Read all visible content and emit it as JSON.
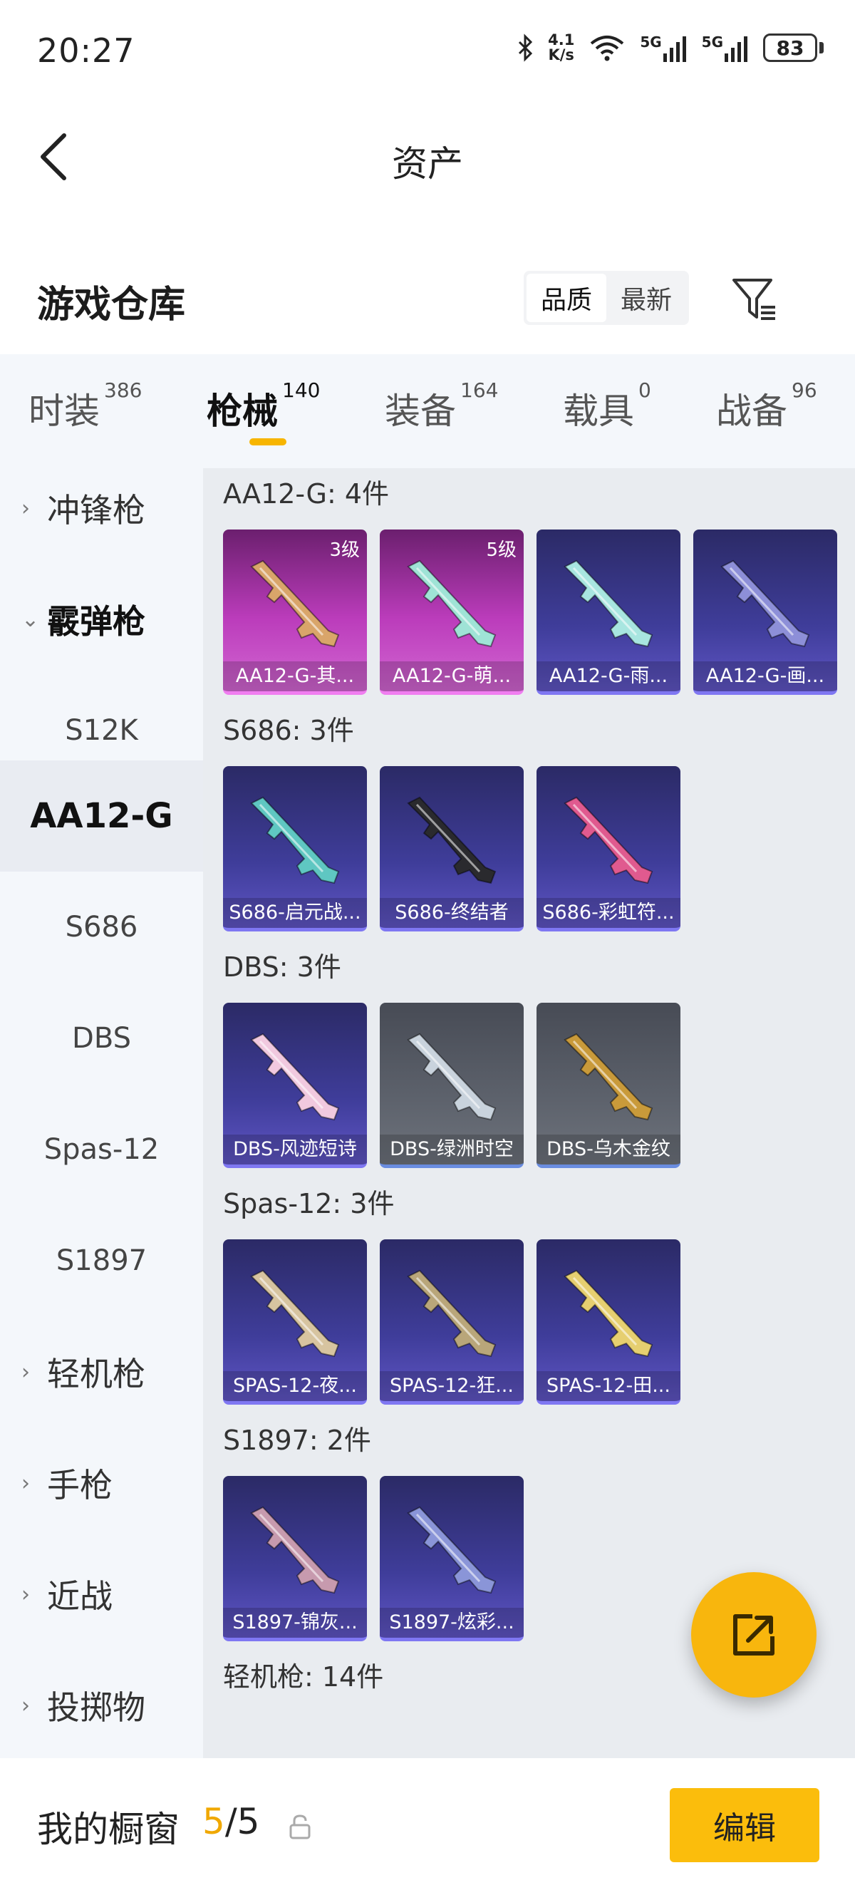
{
  "status": {
    "time": "20:27",
    "net_speed_top": "4.1",
    "net_speed_unit": "K/s",
    "sig1": "5G",
    "sig2": "5G",
    "battery": "83"
  },
  "header": {
    "title": "资产"
  },
  "warehouse": {
    "title": "游戏仓库",
    "sort_options": [
      "品质",
      "最新"
    ],
    "active_sort": "品质"
  },
  "tabs": [
    {
      "label": "时装",
      "count": "386"
    },
    {
      "label": "枪械",
      "count": "140",
      "active": true
    },
    {
      "label": "装备",
      "count": "164"
    },
    {
      "label": "载具",
      "count": "0"
    },
    {
      "label": "战备",
      "count": "96"
    }
  ],
  "sidebar": {
    "items": [
      {
        "label": "冲锋枪",
        "kind": "group"
      },
      {
        "label": "霰弹枪",
        "kind": "group",
        "expanded": true
      },
      {
        "label": "S12K",
        "kind": "sub"
      },
      {
        "label": "AA12-G",
        "kind": "sub",
        "selected": true
      },
      {
        "label": "S686",
        "kind": "sub"
      },
      {
        "label": "DBS",
        "kind": "sub"
      },
      {
        "label": "Spas-12",
        "kind": "sub"
      },
      {
        "label": "S1897",
        "kind": "sub"
      },
      {
        "label": "轻机枪",
        "kind": "group"
      },
      {
        "label": "手枪",
        "kind": "group"
      },
      {
        "label": "近战",
        "kind": "group"
      },
      {
        "label": "投掷物",
        "kind": "group"
      }
    ]
  },
  "sections": [
    {
      "title": "AA12-G: 4件",
      "items": [
        {
          "name": "AA12-G-其...",
          "level": "3级",
          "rarity": "pink",
          "color": "#d9a56a"
        },
        {
          "name": "AA12-G-萌...",
          "level": "5级",
          "rarity": "pink",
          "color": "#9fe3d6"
        },
        {
          "name": "AA12-G-雨...",
          "rarity": "purple",
          "color": "#a8e6e0"
        },
        {
          "name": "AA12-G-画...",
          "rarity": "purple",
          "color": "#8d8fd8"
        }
      ]
    },
    {
      "title": "S686: 3件",
      "items": [
        {
          "name": "S686-启元战...",
          "rarity": "purple",
          "color": "#5fc7c2"
        },
        {
          "name": "S686-终结者",
          "rarity": "purple",
          "color": "#2a2a2e"
        },
        {
          "name": "S686-彩虹符...",
          "rarity": "purple",
          "color": "#e05a8f"
        }
      ]
    },
    {
      "title": "DBS: 3件",
      "items": [
        {
          "name": "DBS-风迹短诗",
          "rarity": "purple",
          "color": "#f1c9df"
        },
        {
          "name": "DBS-绿洲时空",
          "rarity": "gray",
          "color": "#c9d3dd"
        },
        {
          "name": "DBS-乌木金纹",
          "rarity": "gray",
          "color": "#c99a3a"
        }
      ]
    },
    {
      "title": "Spas-12: 3件",
      "items": [
        {
          "name": "SPAS-12-夜...",
          "rarity": "purple",
          "color": "#d7c4a0"
        },
        {
          "name": "SPAS-12-狂...",
          "rarity": "purple",
          "color": "#b9a67a"
        },
        {
          "name": "SPAS-12-田...",
          "rarity": "purple",
          "color": "#e6cf70"
        }
      ]
    },
    {
      "title": "S1897: 2件",
      "items": [
        {
          "name": "S1897-锦灰...",
          "rarity": "purple",
          "color": "#c79aae"
        },
        {
          "name": "S1897-炫彩...",
          "rarity": "purple",
          "color": "#8a95d8"
        }
      ]
    }
  ],
  "trailing_section": {
    "title": "轻机枪: 14件"
  },
  "bottom": {
    "label": "我的橱窗",
    "current": "5",
    "sep": "/",
    "total": "5",
    "edit": "编辑"
  },
  "colors": {
    "accent": "#f8b60d",
    "active_underline": "#f7b500"
  }
}
